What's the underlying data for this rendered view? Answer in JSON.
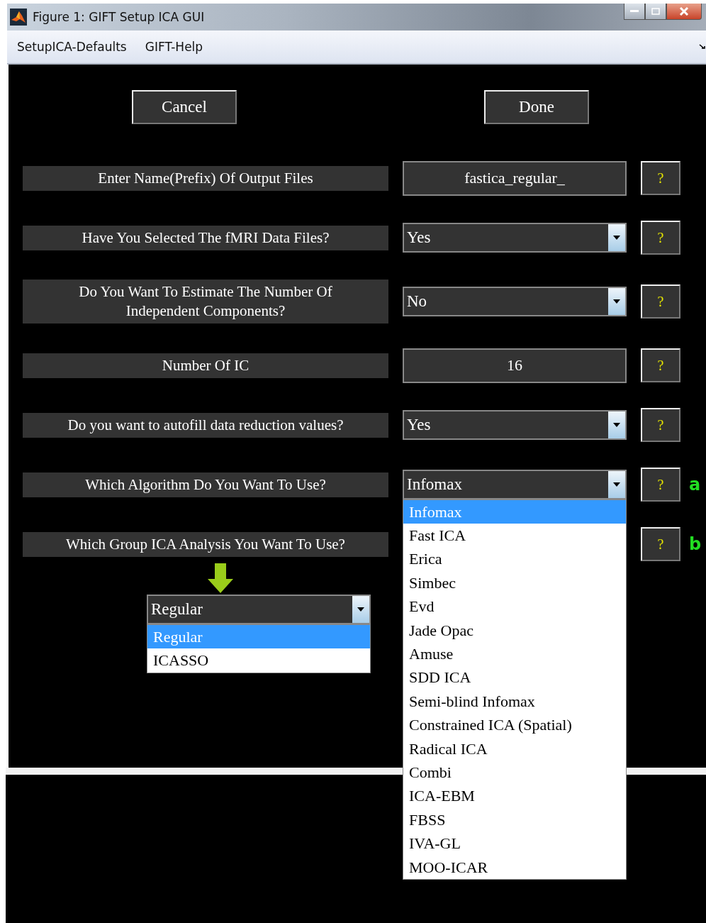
{
  "window": {
    "title": "Figure 1: GIFT Setup ICA GUI"
  },
  "menu": [
    "SetupICA-Defaults",
    "GIFT-Help"
  ],
  "buttons": [
    {
      "label": "Cancel"
    },
    {
      "label": "Done"
    }
  ],
  "rows": [
    {
      "label": "Enter Name(Prefix) Of Output Files",
      "kind": "text",
      "value": "fastica_regular_",
      "help": "?"
    },
    {
      "label": "Have You Selected The fMRI Data Files?",
      "kind": "dropdown",
      "value": "Yes",
      "help": "?"
    },
    {
      "label": "Do You Want To Estimate The Number Of Independent Components?",
      "kind": "dropdown",
      "value": "No",
      "help": "?"
    },
    {
      "label": "Number Of IC",
      "kind": "text",
      "value": "16",
      "help": "?"
    },
    {
      "label": "Do you want to autofill data reduction values?",
      "kind": "dropdown",
      "value": "Yes",
      "help": "?"
    },
    {
      "label": "Which Algorithm Do You Want To Use?",
      "kind": "dropdown",
      "value": "Infomax",
      "help": "?",
      "annotation": "a",
      "expanded": true,
      "options": [
        {
          "label": "Infomax",
          "selected": true
        },
        {
          "label": "Fast ICA",
          "selected": false
        },
        {
          "label": "Erica",
          "selected": false
        },
        {
          "label": "Simbec",
          "selected": false
        },
        {
          "label": "Evd",
          "selected": false
        },
        {
          "label": "Jade Opac",
          "selected": false
        },
        {
          "label": "Amuse",
          "selected": false
        },
        {
          "label": "SDD ICA",
          "selected": false
        },
        {
          "label": "Semi-blind Infomax",
          "selected": false
        },
        {
          "label": "Constrained ICA (Spatial)",
          "selected": false
        },
        {
          "label": "Radical ICA",
          "selected": false
        },
        {
          "label": "Combi",
          "selected": false
        },
        {
          "label": "ICA-EBM",
          "selected": false
        },
        {
          "label": "FBSS",
          "selected": false
        },
        {
          "label": "IVA-GL",
          "selected": false
        },
        {
          "label": "MOO-ICAR",
          "selected": false
        }
      ]
    },
    {
      "label": "Which Group ICA Analysis You Want To Use?",
      "kind": "none",
      "help": "?",
      "annotation": "b"
    }
  ],
  "group_dropdown": {
    "value": "Regular",
    "expanded": true,
    "options": [
      {
        "label": "Regular",
        "selected": true
      },
      {
        "label": "ICASSO",
        "selected": false
      }
    ]
  }
}
